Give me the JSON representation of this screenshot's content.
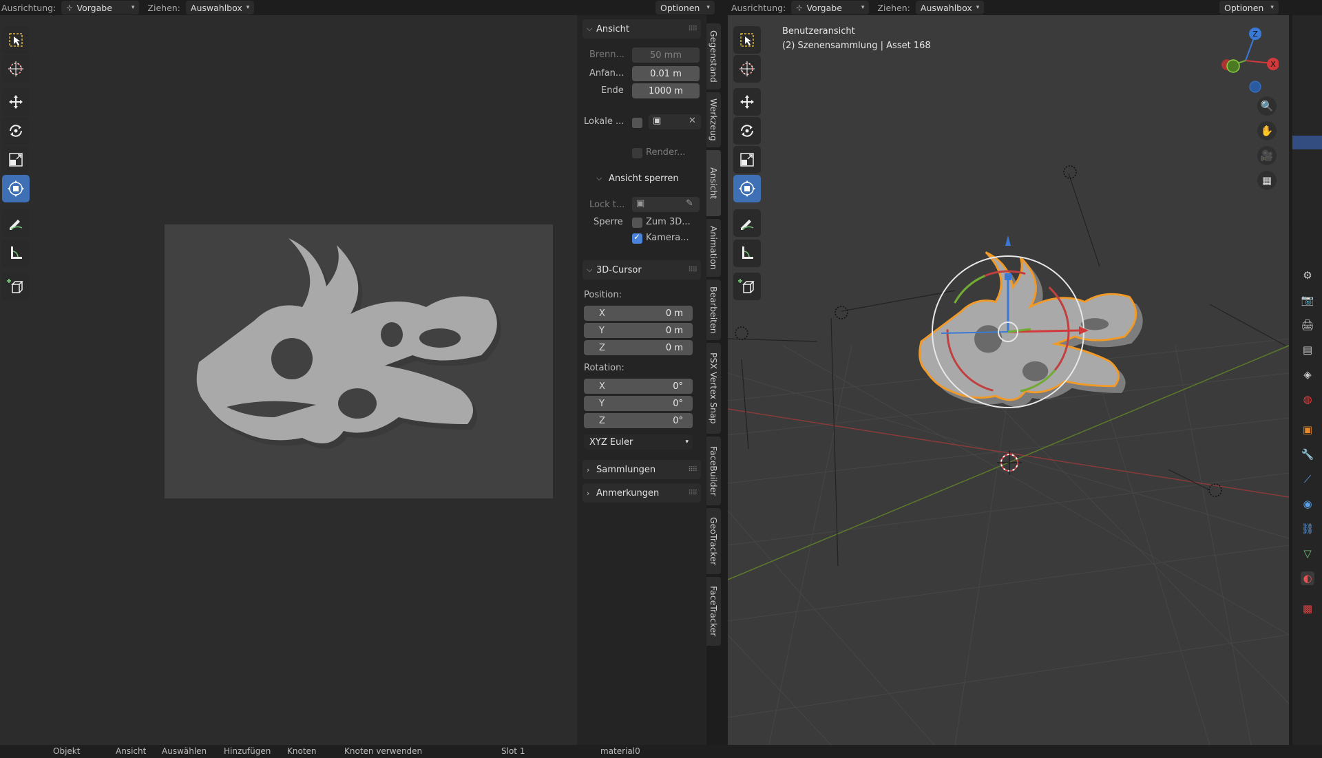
{
  "left_header": {
    "orientation_label": "Ausrichtung:",
    "orientation_value": "Vorgabe",
    "drag_label": "Ziehen:",
    "drag_value": "Auswahlbox",
    "options": "Optionen"
  },
  "right_header": {
    "orientation_label": "Ausrichtung:",
    "orientation_value": "Vorgabe",
    "drag_label": "Ziehen:",
    "drag_value": "Auswahlbox",
    "options": "Optionen"
  },
  "viewport_right": {
    "view_name": "Benutzeransicht",
    "collection_info": "(2) Szenensammlung | Asset 168"
  },
  "gizmo": {
    "x": "X",
    "z": "Z"
  },
  "npanel": {
    "view": {
      "title": "Ansicht",
      "focal_label": "Brenn...",
      "focal_value": "50 mm",
      "clip_start_label": "Anfan...",
      "clip_start_value": "0.01 m",
      "clip_end_label": "Ende",
      "clip_end_value": "1000 m",
      "local_label": "Lokale ...",
      "render_label": "Render...",
      "lock_title": "Ansicht sperren",
      "lock_to_label": "Lock t...",
      "lock_label": "Sperre",
      "lock_3d_label": "Zum 3D...",
      "lock_camera_label": "Kamera..."
    },
    "cursor": {
      "title": "3D-Cursor",
      "position_label": "Position:",
      "pos_x_key": "X",
      "pos_x": "0 m",
      "pos_y_key": "Y",
      "pos_y": "0 m",
      "pos_z_key": "Z",
      "pos_z": "0 m",
      "rotation_label": "Rotation:",
      "rot_x_key": "X",
      "rot_x": "0°",
      "rot_y_key": "Y",
      "rot_y": "0°",
      "rot_z_key": "Z",
      "rot_z": "0°",
      "rotation_mode": "XYZ Euler"
    },
    "collections_title": "Sammlungen",
    "annotations_title": "Anmerkungen"
  },
  "vertical_tabs": [
    "Gegenstand",
    "Werkzeug",
    "Ansicht",
    "Animation",
    "Bearbeiten",
    "PSX Vertex Snap",
    "FaceBuilder",
    "GeoTracker",
    "FaceTracker"
  ],
  "status_bar": {
    "mode": "Objekt",
    "view": "Ansicht",
    "select": "Auswählen",
    "add": "Hinzufügen",
    "node": "Knoten",
    "use_nodes": "Knoten verwenden",
    "slot": "Slot 1",
    "material": "material0"
  },
  "colors": {
    "accent": "#3f6fb5",
    "selection_outline": "#f19a28",
    "axis_x": "#d13a3a",
    "axis_y": "#7ca32b",
    "axis_z": "#3a7ad6"
  }
}
